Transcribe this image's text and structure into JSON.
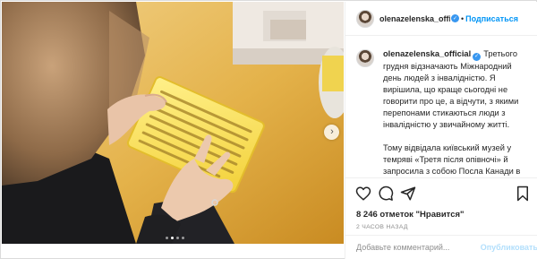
{
  "post": {
    "username": "olenazelenska_offic",
    "separator": "•",
    "follow_label": "Подписаться",
    "caption_username": "olenazelenska_official",
    "caption_paragraphs": [
      "Третього грудня відзначають Міжнародний день людей з інвалідністю. Я вирішила, що краще сьогодні не говорити про це, а відчути, з якими перепонами стикаються люди з інвалідністю у звичайному житті.",
      "Тому відвідала київський музей у темряві «Третя після опівночі» й запросила з собою Посла Канади в Україні пані Ларису Галадзу та"
    ],
    "likes_text": "8 246 отметок \"Нравится\"",
    "timestamp": "2 ЧАСОВ НАЗАД",
    "comment_placeholder": "Добавьте комментарий...",
    "publish_label": "Опубликовать"
  },
  "carousel": {
    "slides": 4,
    "active_index": 1
  },
  "colors": {
    "accent": "#0095f6",
    "verified": "#3897f0",
    "publish_disabled": "#b2dffc",
    "muted": "#8e8e8e"
  },
  "icons": [
    "chevron-right-icon",
    "verified-badge-icon",
    "heart-icon",
    "comment-icon",
    "share-icon",
    "bookmark-icon"
  ]
}
